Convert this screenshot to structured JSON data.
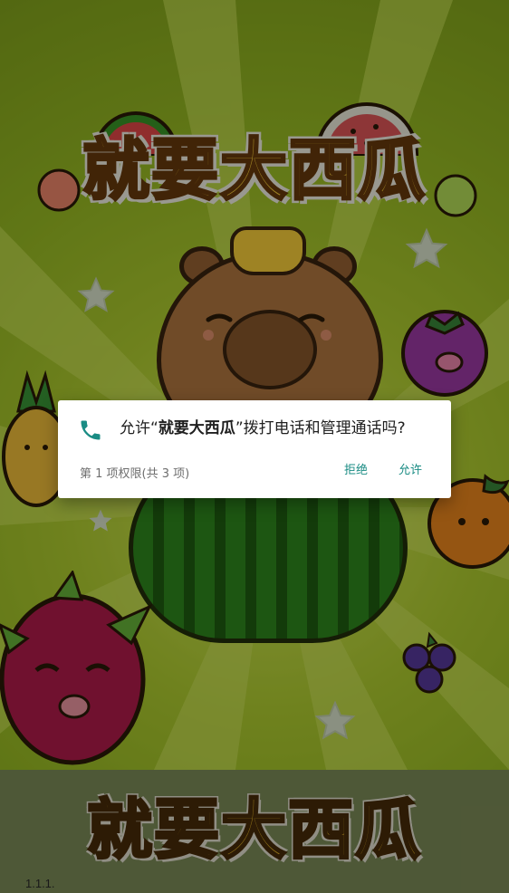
{
  "splash": {
    "logo_text": "就要大西瓜",
    "bottom_logo_text": "就要大西瓜",
    "version": "1.1.1."
  },
  "dialog": {
    "icon": "phone-icon",
    "message_prefix": "允许“",
    "app_name": "就要大西瓜",
    "message_suffix": "”拨打电话和管理通话吗?",
    "permission_count": "第 1 项权限(共 3 项)",
    "deny_label": "拒绝",
    "allow_label": "允许"
  },
  "colors": {
    "accent": "#1a8c84",
    "background": "#9bbf24",
    "logo_fill": "#ffd23a"
  }
}
